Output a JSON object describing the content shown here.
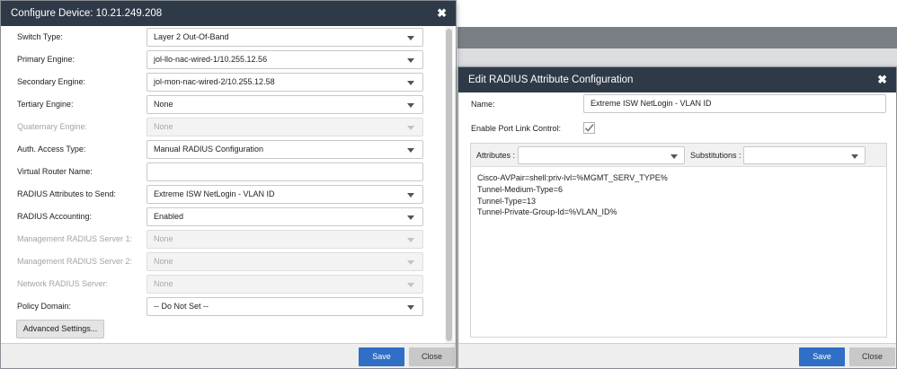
{
  "left_dialog": {
    "title": "Configure Device: 10.21.249.208",
    "fields": [
      {
        "label": "Switch Type:",
        "value": "Layer 2 Out-Of-Band",
        "kind": "select",
        "disabled": false
      },
      {
        "label": "Primary Engine:",
        "value": "jol-llo-nac-wired-1/10.255.12.56",
        "kind": "select",
        "disabled": false
      },
      {
        "label": "Secondary Engine:",
        "value": "jol-mon-nac-wired-2/10.255.12.58",
        "kind": "select",
        "disabled": false
      },
      {
        "label": "Tertiary Engine:",
        "value": "None",
        "kind": "select",
        "disabled": false
      },
      {
        "label": "Quaternary Engine:",
        "value": "None",
        "kind": "select",
        "disabled": true
      },
      {
        "label": "Auth. Access Type:",
        "value": "Manual RADIUS Configuration",
        "kind": "select",
        "disabled": false
      },
      {
        "label": "Virtual Router Name:",
        "value": "",
        "kind": "text",
        "disabled": false
      },
      {
        "label": "RADIUS Attributes to Send:",
        "value": "Extreme ISW NetLogin - VLAN ID",
        "kind": "select",
        "disabled": false
      },
      {
        "label": "RADIUS Accounting:",
        "value": "Enabled",
        "kind": "select",
        "disabled": false
      },
      {
        "label": "Management RADIUS Server 1:",
        "value": "None",
        "kind": "select",
        "disabled": true
      },
      {
        "label": "Management RADIUS Server 2:",
        "value": "None",
        "kind": "select",
        "disabled": true
      },
      {
        "label": "Network RADIUS Server:",
        "value": "None",
        "kind": "select",
        "disabled": true
      },
      {
        "label": "Policy Domain:",
        "value": "-- Do Not Set --",
        "kind": "select",
        "disabled": false
      }
    ],
    "advanced_button": "Advanced Settings...",
    "save_label": "Save",
    "close_label": "Close"
  },
  "right_dialog": {
    "title": "Edit RADIUS Attribute Configuration",
    "name_label": "Name:",
    "name_value": "Extreme ISW NetLogin - VLAN ID",
    "port_link_label": "Enable Port Link Control:",
    "port_link_checked": true,
    "attributes_label": "Attributes :",
    "substitutions_label": "Substitutions :",
    "attribute_lines": [
      "Cisco-AVPair=shell:priv-lvl=%MGMT_SERV_TYPE%",
      "Tunnel-Medium-Type=6",
      "Tunnel-Type=13",
      "Tunnel-Private-Group-Id=%VLAN_ID%"
    ],
    "save_label": "Save",
    "close_label": "Close"
  },
  "colors": {
    "titlebar": "#2f3a48",
    "save_button": "#2f6fc6",
    "close_button": "#c8c8c8",
    "backdrop_dark": "#7a7f85",
    "backdrop_grey": "#dcdde0"
  },
  "icons": {
    "close": "x-icon",
    "dropdown": "chevron-down-icon",
    "checkbox": "checkmark-icon"
  }
}
